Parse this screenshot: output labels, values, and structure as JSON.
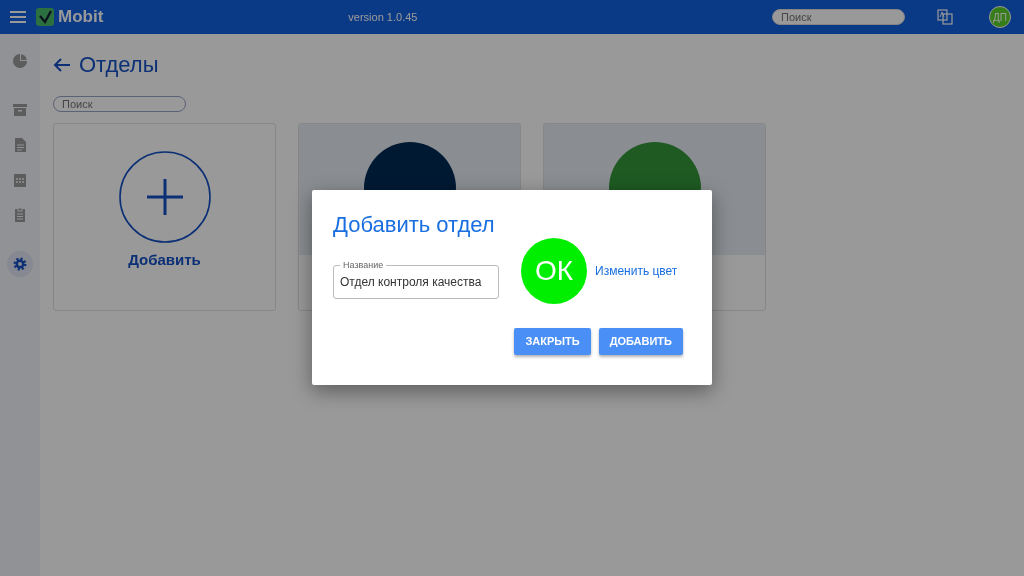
{
  "header": {
    "app_name": "Mobit",
    "version": "version 1.0.45",
    "search": {
      "placeholder": "Поиск"
    },
    "user_initials": "ДП"
  },
  "sidebar": {
    "items": [
      {
        "selected": false
      },
      {
        "selected": false
      },
      {
        "selected": false
      },
      {
        "selected": false
      },
      {
        "selected": false
      },
      {
        "selected": true
      }
    ]
  },
  "page": {
    "title": "Отделы",
    "search": {
      "placeholder": "Поиск"
    },
    "cards": [
      {
        "kind": "add",
        "label": "Добавить"
      },
      {
        "kind": "department"
      },
      {
        "kind": "department"
      }
    ]
  },
  "dialog": {
    "title": "Добавить отдел",
    "field": {
      "label": "Название",
      "value": "Отдел контроля качества"
    },
    "avatar": {
      "initials": "ОК",
      "color": "#00ee00"
    },
    "change_color": "Изменить цвет",
    "buttons": [
      "ЗАКРЫТЬ",
      "ДОБАВИТЬ"
    ]
  }
}
